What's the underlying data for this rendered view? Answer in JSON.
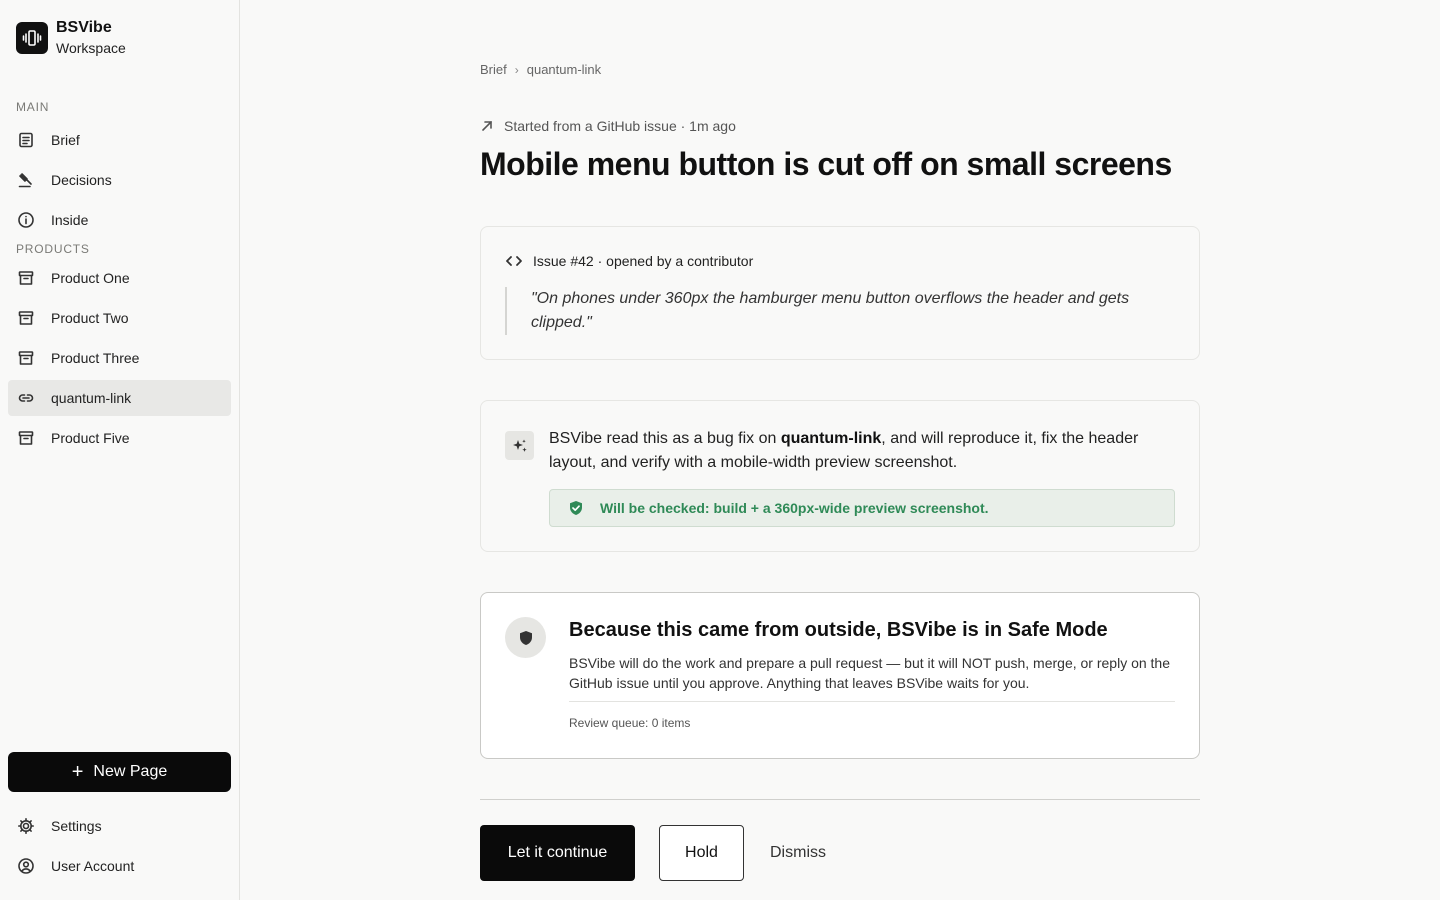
{
  "brand": {
    "name": "BSVibe",
    "subtitle": "Workspace"
  },
  "sidebar": {
    "main_label": "MAIN",
    "main_items": [
      {
        "label": "Brief",
        "icon": "document-icon"
      },
      {
        "label": "Decisions",
        "icon": "gavel-icon"
      },
      {
        "label": "Inside",
        "icon": "info-icon"
      }
    ],
    "products_label": "PRODUCTS",
    "product_items": [
      {
        "label": "Product One",
        "icon": "archive-icon"
      },
      {
        "label": "Product Two",
        "icon": "archive-icon"
      },
      {
        "label": "Product Three",
        "icon": "archive-icon"
      },
      {
        "label": "quantum-link",
        "icon": "link-icon",
        "active": true
      },
      {
        "label": "Product Five",
        "icon": "archive-icon"
      }
    ],
    "new_page_label": "New Page",
    "footer_items": [
      {
        "label": "Settings",
        "icon": "gear-icon"
      },
      {
        "label": "User Account",
        "icon": "user-circle-icon"
      }
    ]
  },
  "breadcrumb": {
    "root": "Brief",
    "current": "quantum-link"
  },
  "origin": {
    "text": "Started from a GitHub issue · 1m ago"
  },
  "page_title": "Mobile menu button is cut off on small screens",
  "issue": {
    "header": "Issue #42 · opened by a contributor",
    "quote": "\"On phones under 360px the hamburger menu button overflows the header and gets clipped.\""
  },
  "reading": {
    "prefix": "BSVibe read this as a bug fix on ",
    "target": "quantum-link",
    "suffix": ", and will reproduce it, fix the header layout, and verify with a mobile-width preview screenshot.",
    "check": "Will be checked: build + a 360px-wide preview screenshot."
  },
  "safe_mode": {
    "title": "Because this came from outside, BSVibe is in Safe Mode",
    "body": "BSVibe will do the work and prepare a pull request — but it will NOT push, merge, or reply on the GitHub issue until you approve. Anything that leaves BSVibe waits for you.",
    "queue": "Review queue: 0 items"
  },
  "actions": {
    "continue": "Let it continue",
    "hold": "Hold",
    "dismiss": "Dismiss"
  },
  "colors": {
    "accent": "#0a0a0a",
    "success": "#2f8a57",
    "active_bg": "#e8e8e6"
  }
}
